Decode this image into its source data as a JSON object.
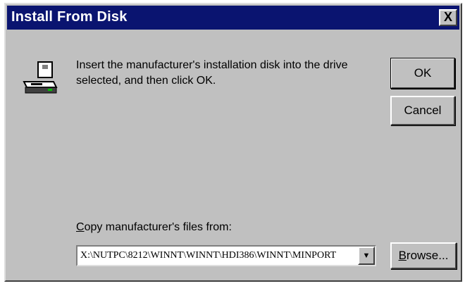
{
  "dialog": {
    "title": "Install From Disk",
    "close_glyph": "X",
    "message": "Insert the manufacturer's installation disk into the drive selected, and then click OK.",
    "ok_label": "OK",
    "cancel_label": "Cancel",
    "copy_label_accel": "C",
    "copy_label_rest": "opy manufacturer's files from:",
    "path_value": "X:\\NUTPC\\8212\\WINNT\\WINNT\\HDI386\\WINNT\\MINPORT",
    "browse_accel": "B",
    "browse_rest": "rowse..."
  },
  "icons": {
    "disk": "disk-drive-icon",
    "dropdown": "chevron-down-icon"
  },
  "colors": {
    "titlebar": "#0a1470",
    "face": "#c0c0c0"
  }
}
